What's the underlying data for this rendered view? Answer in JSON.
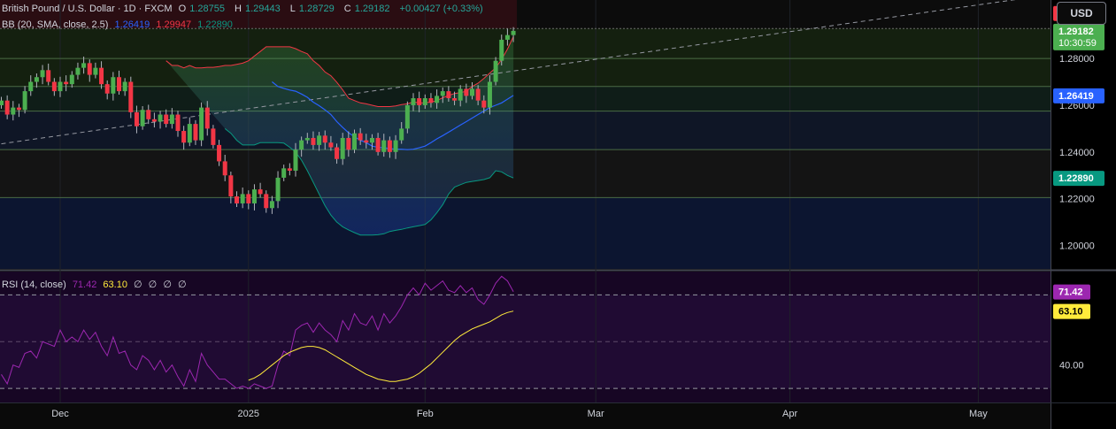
{
  "legend": {
    "symbol": "British Pound / U.S. Dollar · 1D · FXCM",
    "o_label": "O",
    "o_value": "1.28755",
    "h_label": "H",
    "h_value": "1.29443",
    "l_label": "L",
    "l_value": "1.28729",
    "c_label": "C",
    "c_value": "1.29182",
    "change": "+0.00427 (+0.33%)",
    "bb_title": "BB (20, SMA, close, 2.5)",
    "bb_basis": "1.26419",
    "bb_upper": "1.29947",
    "bb_lower": "1.22890",
    "rsi_title": "RSI (14, close)",
    "rsi_value": "71.42",
    "rsi_ma": "63.10",
    "rsi_extra": [
      "∅",
      "∅",
      "∅",
      "∅"
    ]
  },
  "currency_button": "USD",
  "colors": {
    "up": "#4caf50",
    "down": "#f23645",
    "bb_upper": "#f23645",
    "bb_basis": "#2962ff",
    "bb_lower": "#089981",
    "rsi": "#9c27b0",
    "rsi_ma": "#ffeb3b"
  },
  "chart_data": [
    {
      "type": "candlestick",
      "title": "British Pound / U.S. Dollar · 1D · FXCM",
      "ylim": [
        1.19,
        1.305
      ],
      "y_ticks": [
        "1.20000",
        "1.22000",
        "1.24000",
        "1.26000",
        "1.28000"
      ],
      "x_ticks": [
        {
          "label": "Dec",
          "index": 10
        },
        {
          "label": "2025",
          "index": 42
        },
        {
          "label": "Feb",
          "index": 72
        },
        {
          "label": "Mar",
          "index": 101
        },
        {
          "label": "Apr",
          "index": 134
        },
        {
          "label": "May",
          "index": 166
        }
      ],
      "price_labels": [
        {
          "text": "1.29947",
          "value": 1.2994,
          "color": "#f23645"
        },
        {
          "text": "1.29182",
          "value": 1.2918,
          "color": "#4caf50",
          "sub": "10:30:59"
        },
        {
          "text": "1.26419",
          "value": 1.2642,
          "color": "#2962ff"
        },
        {
          "text": "1.22890",
          "value": 1.2289,
          "color": "#089981"
        }
      ],
      "horizontal_levels": [
        1.2928,
        1.28,
        1.268,
        1.2575,
        1.241,
        1.2205
      ],
      "trendline": {
        "from": {
          "index": 0,
          "value": 1.2435
        },
        "to": {
          "index": 183,
          "value": 1.309
        }
      },
      "close": [
        1.262,
        1.256,
        1.259,
        1.258,
        1.266,
        1.27,
        1.272,
        1.275,
        1.27,
        1.266,
        1.27,
        1.269,
        1.273,
        1.276,
        1.278,
        1.273,
        1.276,
        1.269,
        1.265,
        1.272,
        1.266,
        1.27,
        1.257,
        1.251,
        1.258,
        1.254,
        1.253,
        1.256,
        1.252,
        1.256,
        1.249,
        1.244,
        1.252,
        1.245,
        1.259,
        1.25,
        1.243,
        1.236,
        1.23,
        1.221,
        1.218,
        1.222,
        1.218,
        1.224,
        1.222,
        1.216,
        1.219,
        1.229,
        1.233,
        1.232,
        1.241,
        1.245,
        1.246,
        1.243,
        1.247,
        1.244,
        1.242,
        1.237,
        1.246,
        1.241,
        1.248,
        1.245,
        1.244,
        1.246,
        1.24,
        1.245,
        1.24,
        1.245,
        1.25,
        1.26,
        1.263,
        1.26,
        1.263,
        1.261,
        1.264,
        1.266,
        1.263,
        1.262,
        1.267,
        1.264,
        1.267,
        1.262,
        1.259,
        1.27,
        1.279,
        1.288,
        1.29,
        1.2918
      ],
      "bb_upper": [
        1.279,
        1.277,
        1.277,
        1.276,
        1.277,
        1.276,
        1.276,
        1.2762,
        1.2762,
        1.2765,
        1.277,
        1.277,
        1.2775,
        1.278,
        1.279,
        1.281,
        1.283,
        1.285,
        1.285,
        1.285,
        1.285,
        1.285,
        1.2842,
        1.283,
        1.282,
        1.279,
        1.277,
        1.2742,
        1.2726,
        1.2698,
        1.2666,
        1.263,
        1.262,
        1.261,
        1.2606,
        1.26,
        1.2594,
        1.2594,
        1.2594,
        1.2597,
        1.2603,
        1.2606,
        1.2614,
        1.261,
        1.261,
        1.2614,
        1.262,
        1.2632,
        1.2642,
        1.265,
        1.2654,
        1.266,
        1.268,
        1.2694,
        1.2715,
        1.2738,
        1.276,
        1.2796,
        1.284,
        1.2893
      ],
      "bb_basis": [
        1.27,
        1.268,
        1.2672,
        1.2665,
        1.266,
        1.2648,
        1.2634,
        1.2613,
        1.2598,
        1.258,
        1.256,
        1.253,
        1.2505,
        1.2482,
        1.2465,
        1.245,
        1.244,
        1.2425,
        1.242,
        1.2418,
        1.2415,
        1.2412,
        1.2412,
        1.241,
        1.2412,
        1.2418,
        1.2425,
        1.244,
        1.2456,
        1.247,
        1.2485,
        1.25,
        1.2515,
        1.253,
        1.2545,
        1.256,
        1.2575,
        1.259,
        1.26,
        1.261,
        1.2626,
        1.2642
      ],
      "bb_lower": [
        1.25,
        1.248,
        1.245,
        1.243,
        1.243,
        1.243,
        1.244,
        1.244,
        1.244,
        1.244,
        1.2438,
        1.242,
        1.24,
        1.2365,
        1.232,
        1.227,
        1.222,
        1.217,
        1.213,
        1.21,
        1.208,
        1.2067,
        1.2055,
        1.2045,
        1.2045,
        1.2045,
        1.2046,
        1.205,
        1.206,
        1.2065,
        1.2069,
        1.2075,
        1.208,
        1.2085,
        1.209,
        1.211,
        1.214,
        1.2175,
        1.222,
        1.225,
        1.226,
        1.227,
        1.2274,
        1.2278,
        1.2282,
        1.229,
        1.232,
        1.2315,
        1.23,
        1.2289
      ]
    },
    {
      "type": "line",
      "title": "RSI (14, close)",
      "ylim": [
        24,
        80
      ],
      "y_ticks": [
        "40.00"
      ],
      "bands": [
        70,
        50,
        30
      ],
      "series": [
        {
          "name": "RSI",
          "values": [
            36,
            32,
            40,
            39,
            45,
            46,
            43,
            50,
            49,
            48,
            55,
            50,
            52,
            50,
            55,
            51,
            54,
            48,
            44,
            52,
            45,
            46,
            40,
            38,
            44,
            42,
            38,
            42,
            37,
            40,
            35,
            31,
            38,
            33,
            45,
            40,
            37,
            34,
            34,
            32,
            30,
            31,
            30,
            32,
            31,
            30,
            31,
            40,
            46,
            44,
            55,
            57,
            58,
            54,
            58,
            55,
            53,
            50,
            59,
            55,
            62,
            58,
            57,
            61,
            55,
            62,
            58,
            61,
            65,
            70,
            73,
            70,
            75,
            72,
            74,
            76,
            72,
            71,
            74,
            71,
            73,
            68,
            66,
            70,
            75,
            78,
            76,
            71.42
          ]
        },
        {
          "name": "MA",
          "values": [
            33.5,
            34.5,
            36,
            38,
            40,
            42,
            44,
            45.5,
            46.5,
            47.5,
            48,
            48,
            47.5,
            46.5,
            45,
            43.5,
            42,
            40.5,
            39,
            37.5,
            36,
            35,
            34,
            33.5,
            33,
            33,
            33.5,
            34,
            35,
            36.5,
            38.5,
            40.5,
            43,
            45.5,
            48,
            50.5,
            52.5,
            54,
            55.5,
            56.5,
            57.5,
            58.5,
            60,
            61.5,
            62.5,
            63.1
          ]
        }
      ]
    }
  ]
}
